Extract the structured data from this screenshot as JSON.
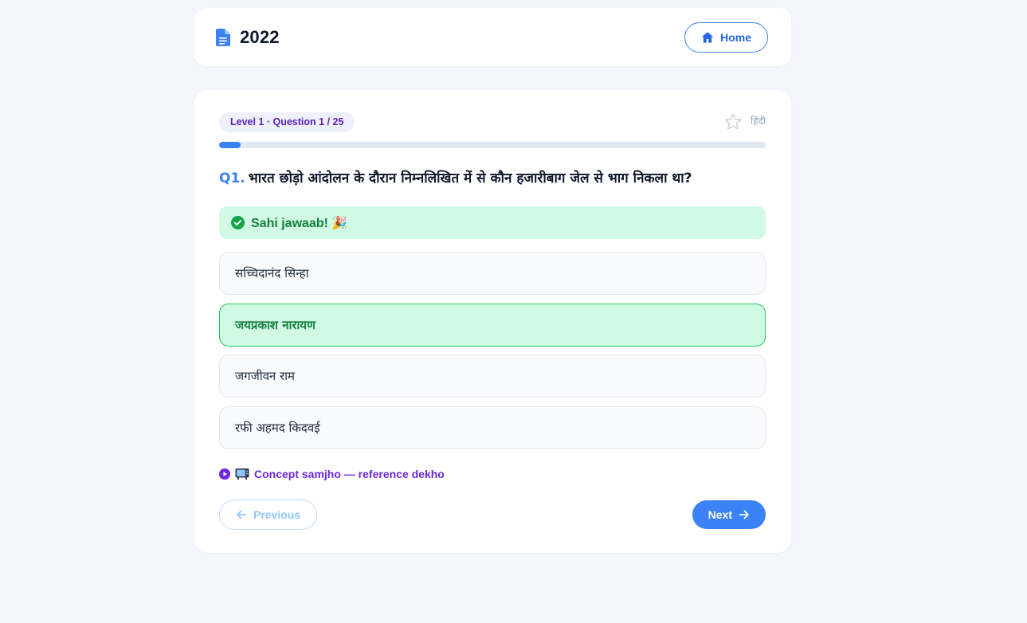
{
  "header": {
    "title": "2022",
    "home_label": "Home"
  },
  "quiz": {
    "level_label": "Level 1 · Question 1 / 25",
    "language_toggle": "हिंदी",
    "progress": 0.04,
    "question_number": "Q1.",
    "question_text": "भारत छोड़ो आंदोलन के दौरान निम्नलिखित में से कौन हजारीबाग जेल से भाग निकला था?",
    "feedback_text": "Sahi jawaab! 🎉",
    "options": [
      {
        "label": "सच्चिदानंद सिन्हा",
        "state": "default"
      },
      {
        "label": "जयप्रकाश नारायण",
        "state": "correct"
      },
      {
        "label": "जगजीवन राम",
        "state": "default"
      },
      {
        "label": "रफी अहमद किदवई",
        "state": "default"
      }
    ],
    "concept_link": "Concept samjho — reference dekho",
    "previous_label": "Previous",
    "next_label": "Next"
  },
  "colors": {
    "accent": "#3b82f6",
    "success_bg": "#d1fae5",
    "success_text": "#15803d",
    "badge_text": "#5b21b6"
  },
  "icons": {
    "title": "document-icon",
    "home": "home-icon",
    "bookmark": "star-icon",
    "feedback": "check-circle-icon",
    "concept": "play-circle-icon",
    "concept_emoji": "tv-icon",
    "previous": "arrow-left-icon",
    "next": "arrow-right-icon"
  }
}
